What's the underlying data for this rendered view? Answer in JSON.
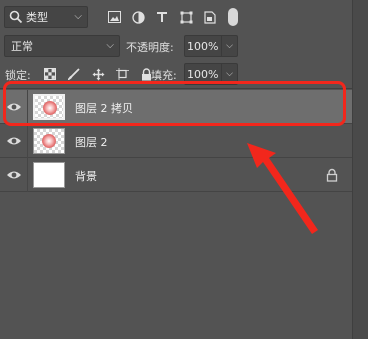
{
  "filter": {
    "label": "类型"
  },
  "blend": {
    "mode": "正常",
    "opacity_label": "不透明度:",
    "opacity_value": "100%"
  },
  "lock": {
    "label": "锁定:",
    "fill_label": "填充:",
    "fill_value": "100%"
  },
  "layers": [
    {
      "name": "图层 2 拷贝",
      "selected": true
    },
    {
      "name": "图层 2",
      "selected": false
    },
    {
      "name": "背景",
      "locked": true
    }
  ],
  "colors": {
    "panel": "#535353",
    "selected": "#6e6e6e",
    "annotation": "#f2271c"
  }
}
